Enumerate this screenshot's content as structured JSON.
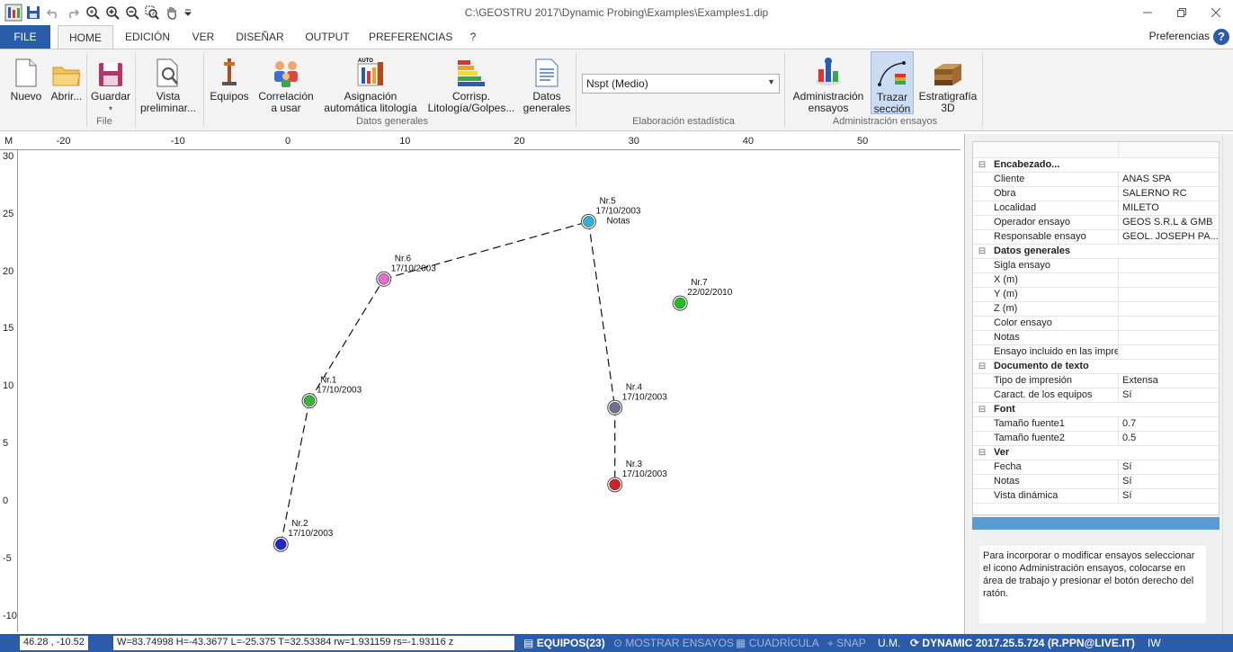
{
  "window": {
    "title": "C:\\GEOSTRU 2017\\Dynamic Probing\\Examples\\Examples1.dip"
  },
  "tabs": [
    "FILE",
    "HOME",
    "EDICIÓN",
    "VER",
    "DISEÑAR",
    "OUTPUT",
    "PREFERENCIAS",
    "?"
  ],
  "active_tab": "HOME",
  "preferences_link": "Preferencias",
  "ribbon": {
    "nuevo": "Nuevo",
    "abrir": "Abrir...",
    "guardar": "Guardar",
    "vista_l1": "Vista",
    "vista_l2": "preliminar...",
    "equipos": "Equipos",
    "correl_l1": "Correlación",
    "correl_l2": "a usar",
    "asign_l1": "Asignación",
    "asign_l2": "automática litología",
    "corrisp_l1": "Corrisp.",
    "corrisp_l2": "Litología/Golpes...",
    "datos_l1": "Datos",
    "datos_l2": "generales",
    "combo_value": "Nspt (Medio)",
    "admin_l1": "Administración",
    "admin_l2": "ensayos",
    "trazar_l1": "Trazar",
    "trazar_l2": "sección",
    "estrat_l1": "Estratigrafía",
    "estrat_l2": "3D",
    "auto_badge": "AUTO",
    "groups": {
      "file": "File",
      "datos": "Datos generales",
      "elab": "Elaboración estadística",
      "admin": "Administración ensayos"
    }
  },
  "map": {
    "corner": "M",
    "x_ticks": [
      "-20",
      "-10",
      "0",
      "10",
      "20",
      "30",
      "40",
      "50"
    ],
    "y_ticks": [
      "30",
      "25",
      "20",
      "15",
      "10",
      "5",
      "0",
      "-5",
      "-10"
    ],
    "tests": [
      {
        "name": "Nr.1",
        "date": "17/10/2003",
        "note": "",
        "x": 1.5,
        "y": 8.8,
        "color": "#3cb43c"
      },
      {
        "name": "Nr.2",
        "date": "17/10/2003",
        "note": "",
        "x": -1.0,
        "y": -3.7,
        "color": "#2424c8"
      },
      {
        "name": "Nr.3",
        "date": "17/10/2003",
        "note": "",
        "x": 28.2,
        "y": 1.5,
        "color": "#d42020"
      },
      {
        "name": "Nr.4",
        "date": "17/10/2003",
        "note": "",
        "x": 28.2,
        "y": 8.2,
        "color": "#707090"
      },
      {
        "name": "Nr.5",
        "date": "17/10/2003",
        "note": "Notas",
        "x": 25.9,
        "y": 24.4,
        "color": "#33b0d8"
      },
      {
        "name": "Nr.6",
        "date": "17/10/2003",
        "note": "",
        "x": 8.0,
        "y": 19.4,
        "color": "#e070d0"
      },
      {
        "name": "Nr.7",
        "date": "22/02/2010",
        "note": "",
        "x": 33.9,
        "y": 17.3,
        "color": "#20c020"
      }
    ],
    "section_path": [
      "Nr.2",
      "Nr.1",
      "Nr.6",
      "Nr.5",
      "Nr.4",
      "Nr.3"
    ]
  },
  "properties": {
    "sections": [
      {
        "title": "Encabezado...",
        "rows": [
          {
            "key": "Cliente",
            "value": "ANAS SPA"
          },
          {
            "key": "Obra",
            "value": "SALERNO RC"
          },
          {
            "key": "Localidad",
            "value": "MILETO"
          },
          {
            "key": "Operador ensayo",
            "value": "GEOS S.R.L & GMB"
          },
          {
            "key": "Responsable ensayo",
            "value": "GEOL. JOSEPH PA..."
          }
        ]
      },
      {
        "title": "Datos generales",
        "rows": [
          {
            "key": "Sigla ensayo",
            "value": ""
          },
          {
            "key": "X (m)",
            "value": ""
          },
          {
            "key": "Y (m)",
            "value": ""
          },
          {
            "key": "Z (m)",
            "value": ""
          },
          {
            "key": "Color ensayo",
            "value": ""
          },
          {
            "key": "Notas",
            "value": ""
          },
          {
            "key": "Ensayo incluido en las impresiones",
            "value": ""
          }
        ]
      },
      {
        "title": "Documento de texto",
        "rows": [
          {
            "key": "Tipo de impresión",
            "value": "Extensa"
          },
          {
            "key": "Caract. de los equipos",
            "value": "Sí"
          }
        ]
      },
      {
        "title": "Font",
        "rows": [
          {
            "key": "Tamaño fuente1",
            "value": "0.7"
          },
          {
            "key": "Tamaño fuente2",
            "value": "0.5"
          }
        ]
      },
      {
        "title": "Ver",
        "rows": [
          {
            "key": "Fecha",
            "value": "Sí"
          },
          {
            "key": "Notas",
            "value": "Sí"
          },
          {
            "key": "Vista dinámica",
            "value": "Sí"
          }
        ]
      }
    ],
    "hint": "Para incorporar o modificar ensayos seleccionar el icono Administración ensayos, colocarse en área de trabajo y  presionar el botón derecho del ratón."
  },
  "status": {
    "coords": "46.28 , -10.52",
    "measure": "W=83.74998 H=-43.3677 L=-25.375 T=32.53384 rw=1.931159 rs=-1.93116 z",
    "equipos": "EQUIPOS(23)",
    "mostrar": "MOSTRAR ENSAYOS",
    "cuadricula": "CUADRÍCULA",
    "snap": "SNAP",
    "um": "U.M.",
    "version": "DYNAMIC 2017.25.5.724 (R.PPN@LIVE.IT)",
    "lang": "IW"
  },
  "colors": {
    "accent": "#2a5caa",
    "ribbon_bg": "#f3f3f3",
    "selected": "#c9dcf2"
  }
}
